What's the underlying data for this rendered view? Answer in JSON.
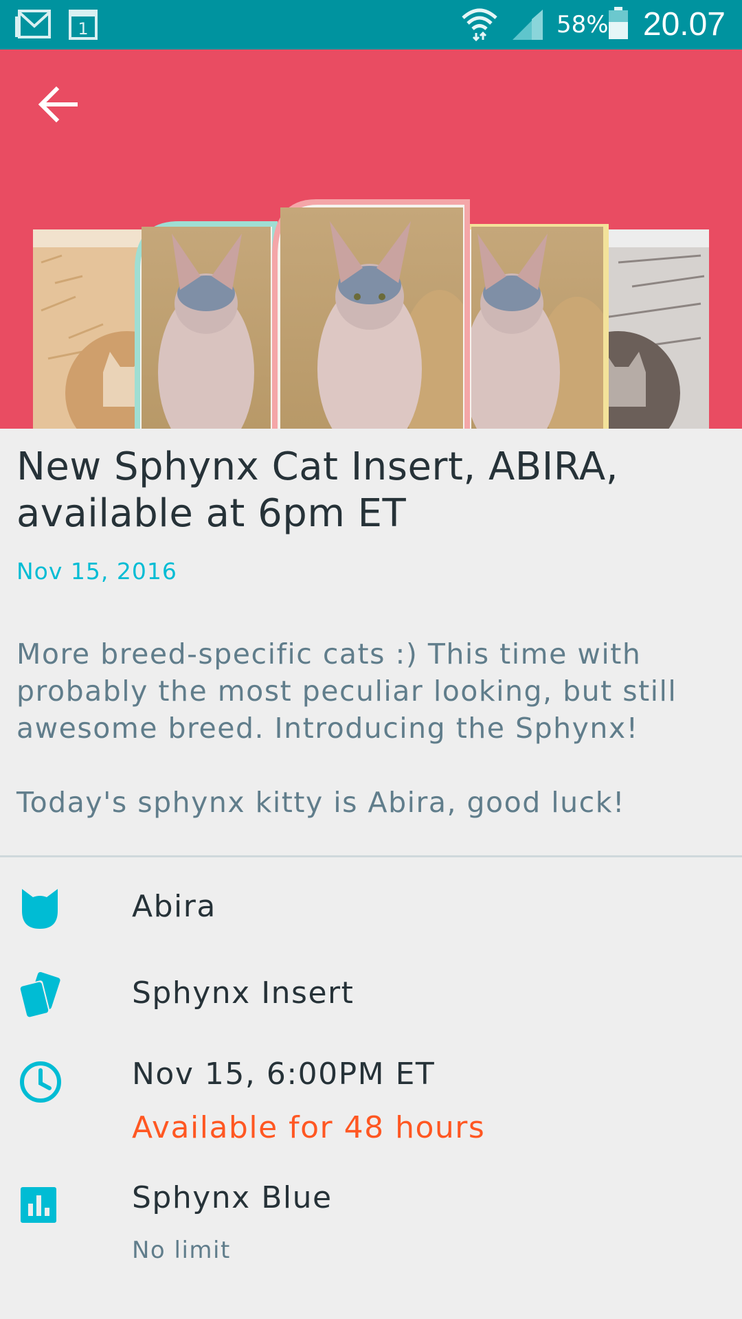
{
  "status_bar": {
    "calendar_day": "1",
    "battery_percent": "58%",
    "time": "20.07",
    "icons": [
      "gmail-icon",
      "calendar-icon",
      "wifi-icon",
      "signal-icon",
      "battery-icon"
    ]
  },
  "header": {
    "back_icon": "arrow-left-icon",
    "color": "#e94c62"
  },
  "article": {
    "title": "New Sphynx Cat Insert, ABIRA, available at 6pm ET",
    "date": "Nov 15, 2016",
    "paragraphs": [
      "More breed-specific cats :) This time with probably the most peculiar looking, but still awesome breed. Introducing the Sphynx!",
      "Today's sphynx kitty is Abira, good luck!"
    ]
  },
  "details": {
    "cat_name": "Abira",
    "insert_name": "Sphynx Insert",
    "release_time": "Nov 15, 6:00PM ET",
    "availability": "Available for 48 hours",
    "variant": "Sphynx Blue",
    "limit": "No limit"
  },
  "colors": {
    "status_bar": "#00939f",
    "accent": "#00bcd4",
    "availability": "#ff5722",
    "body_text": "#607d8b",
    "title_text": "#263238"
  }
}
